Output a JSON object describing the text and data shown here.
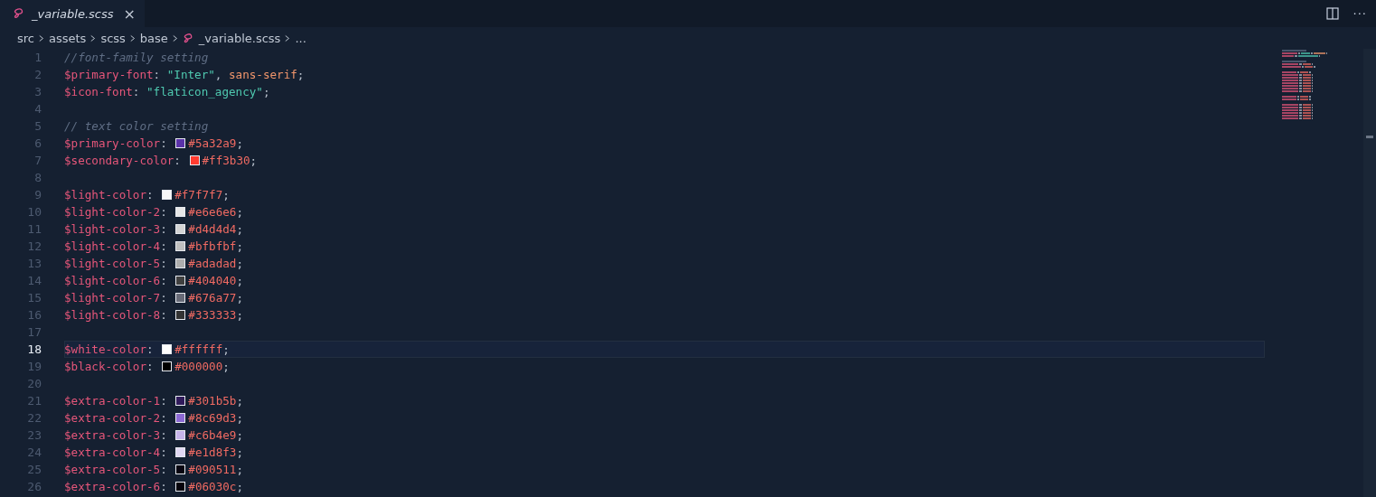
{
  "tab": {
    "label": "_variable.scss",
    "selected": true,
    "close": "×"
  },
  "breadcrumbs": [
    {
      "label": "src",
      "kind": "folder"
    },
    {
      "label": "assets",
      "kind": "folder"
    },
    {
      "label": "scss",
      "kind": "folder"
    },
    {
      "label": "base",
      "kind": "folder"
    },
    {
      "label": "_variable.scss",
      "kind": "file"
    },
    {
      "label": "...",
      "kind": "more"
    }
  ],
  "actions": {
    "more": "···"
  },
  "lines": [
    {
      "number": "1",
      "current": false,
      "tokens": [
        {
          "kind": "comment",
          "text": "//font-family setting"
        }
      ]
    },
    {
      "number": "2",
      "current": false,
      "tokens": [
        {
          "kind": "variable",
          "text": "$primary-font"
        },
        {
          "kind": "punct",
          "text": ": "
        },
        {
          "kind": "string",
          "text": "\"Inter\""
        },
        {
          "kind": "punct",
          "text": ", "
        },
        {
          "kind": "keyword",
          "text": "sans-serif"
        },
        {
          "kind": "punct",
          "text": ";"
        }
      ]
    },
    {
      "number": "3",
      "current": false,
      "tokens": [
        {
          "kind": "variable",
          "text": "$icon-font"
        },
        {
          "kind": "punct",
          "text": ": "
        },
        {
          "kind": "string",
          "text": "\"flaticon_agency\""
        },
        {
          "kind": "punct",
          "text": ";"
        }
      ]
    },
    {
      "number": "4",
      "current": false
    },
    {
      "number": "5",
      "current": false,
      "tokens": [
        {
          "kind": "comment",
          "text": "// text color setting"
        }
      ]
    },
    {
      "number": "6",
      "current": false,
      "tokens": [
        {
          "kind": "variable",
          "text": "$primary-color"
        },
        {
          "kind": "punct",
          "text": ": "
        },
        {
          "kind": "swatch",
          "color": "#5a32a9"
        },
        {
          "kind": "hex",
          "text": "#5a32a9"
        },
        {
          "kind": "punct",
          "text": ";"
        }
      ]
    },
    {
      "number": "7",
      "current": false,
      "tokens": [
        {
          "kind": "variable",
          "text": "$secondary-color"
        },
        {
          "kind": "punct",
          "text": ": "
        },
        {
          "kind": "swatch",
          "color": "#ff3b30"
        },
        {
          "kind": "hex",
          "text": "#ff3b30"
        },
        {
          "kind": "punct",
          "text": ";"
        }
      ]
    },
    {
      "number": "8",
      "current": false
    },
    {
      "number": "9",
      "current": false,
      "tokens": [
        {
          "kind": "variable",
          "text": "$light-color"
        },
        {
          "kind": "punct",
          "text": ": "
        },
        {
          "kind": "swatch",
          "color": "#f7f7f7"
        },
        {
          "kind": "hex",
          "text": "#f7f7f7"
        },
        {
          "kind": "punct",
          "text": ";"
        }
      ]
    },
    {
      "number": "10",
      "current": false,
      "tokens": [
        {
          "kind": "variable",
          "text": "$light-color-2"
        },
        {
          "kind": "punct",
          "text": ": "
        },
        {
          "kind": "swatch",
          "color": "#e6e6e6"
        },
        {
          "kind": "hex",
          "text": "#e6e6e6"
        },
        {
          "kind": "punct",
          "text": ";"
        }
      ]
    },
    {
      "number": "11",
      "current": false,
      "tokens": [
        {
          "kind": "variable",
          "text": "$light-color-3"
        },
        {
          "kind": "punct",
          "text": ": "
        },
        {
          "kind": "swatch",
          "color": "#d4d4d4"
        },
        {
          "kind": "hex",
          "text": "#d4d4d4"
        },
        {
          "kind": "punct",
          "text": ";"
        }
      ]
    },
    {
      "number": "12",
      "current": false,
      "tokens": [
        {
          "kind": "variable",
          "text": "$light-color-4"
        },
        {
          "kind": "punct",
          "text": ": "
        },
        {
          "kind": "swatch",
          "color": "#bfbfbf"
        },
        {
          "kind": "hex",
          "text": "#bfbfbf"
        },
        {
          "kind": "punct",
          "text": ";"
        }
      ]
    },
    {
      "number": "13",
      "current": false,
      "tokens": [
        {
          "kind": "variable",
          "text": "$light-color-5"
        },
        {
          "kind": "punct",
          "text": ": "
        },
        {
          "kind": "swatch",
          "color": "#adadad"
        },
        {
          "kind": "hex",
          "text": "#adadad"
        },
        {
          "kind": "punct",
          "text": ";"
        }
      ]
    },
    {
      "number": "14",
      "current": false,
      "tokens": [
        {
          "kind": "variable",
          "text": "$light-color-6"
        },
        {
          "kind": "punct",
          "text": ": "
        },
        {
          "kind": "swatch",
          "color": "#404040"
        },
        {
          "kind": "hex",
          "text": "#404040"
        },
        {
          "kind": "punct",
          "text": ";"
        }
      ]
    },
    {
      "number": "15",
      "current": false,
      "tokens": [
        {
          "kind": "variable",
          "text": "$light-color-7"
        },
        {
          "kind": "punct",
          "text": ": "
        },
        {
          "kind": "swatch",
          "color": "#676a77"
        },
        {
          "kind": "hex",
          "text": "#676a77"
        },
        {
          "kind": "punct",
          "text": ";"
        }
      ]
    },
    {
      "number": "16",
      "current": false,
      "tokens": [
        {
          "kind": "variable",
          "text": "$light-color-8"
        },
        {
          "kind": "punct",
          "text": ": "
        },
        {
          "kind": "swatch",
          "color": "#333333"
        },
        {
          "kind": "hex",
          "text": "#333333"
        },
        {
          "kind": "punct",
          "text": ";"
        }
      ]
    },
    {
      "number": "17",
      "current": false
    },
    {
      "number": "18",
      "current": true,
      "tokens": [
        {
          "kind": "variable",
          "text": "$white-color"
        },
        {
          "kind": "punct",
          "text": ": "
        },
        {
          "kind": "swatch",
          "color": "#ffffff"
        },
        {
          "kind": "hex",
          "text": "#ffffff"
        },
        {
          "kind": "punct",
          "text": ";"
        }
      ]
    },
    {
      "number": "19",
      "current": false,
      "tokens": [
        {
          "kind": "variable",
          "text": "$black-color"
        },
        {
          "kind": "punct",
          "text": ": "
        },
        {
          "kind": "swatch",
          "color": "#000000"
        },
        {
          "kind": "hex",
          "text": "#000000"
        },
        {
          "kind": "punct",
          "text": ";"
        }
      ]
    },
    {
      "number": "20",
      "current": false
    },
    {
      "number": "21",
      "current": false,
      "tokens": [
        {
          "kind": "variable",
          "text": "$extra-color-1"
        },
        {
          "kind": "punct",
          "text": ": "
        },
        {
          "kind": "swatch",
          "color": "#301b5b"
        },
        {
          "kind": "hex",
          "text": "#301b5b"
        },
        {
          "kind": "punct",
          "text": ";"
        }
      ]
    },
    {
      "number": "22",
      "current": false,
      "tokens": [
        {
          "kind": "variable",
          "text": "$extra-color-2"
        },
        {
          "kind": "punct",
          "text": ": "
        },
        {
          "kind": "swatch",
          "color": "#8c69d3"
        },
        {
          "kind": "hex",
          "text": "#8c69d3"
        },
        {
          "kind": "punct",
          "text": ";"
        }
      ]
    },
    {
      "number": "23",
      "current": false,
      "tokens": [
        {
          "kind": "variable",
          "text": "$extra-color-3"
        },
        {
          "kind": "punct",
          "text": ": "
        },
        {
          "kind": "swatch",
          "color": "#c6b4e9"
        },
        {
          "kind": "hex",
          "text": "#c6b4e9"
        },
        {
          "kind": "punct",
          "text": ";"
        }
      ]
    },
    {
      "number": "24",
      "current": false,
      "tokens": [
        {
          "kind": "variable",
          "text": "$extra-color-4"
        },
        {
          "kind": "punct",
          "text": ": "
        },
        {
          "kind": "swatch",
          "color": "#e1d8f3"
        },
        {
          "kind": "hex",
          "text": "#e1d8f3"
        },
        {
          "kind": "punct",
          "text": ";"
        }
      ]
    },
    {
      "number": "25",
      "current": false,
      "tokens": [
        {
          "kind": "variable",
          "text": "$extra-color-5"
        },
        {
          "kind": "punct",
          "text": ": "
        },
        {
          "kind": "swatch",
          "color": "#090511"
        },
        {
          "kind": "hex",
          "text": "#090511"
        },
        {
          "kind": "punct",
          "text": ";"
        }
      ]
    },
    {
      "number": "26",
      "current": false,
      "tokens": [
        {
          "kind": "variable",
          "text": "$extra-color-6"
        },
        {
          "kind": "punct",
          "text": ": "
        },
        {
          "kind": "swatch",
          "color": "#06030c"
        },
        {
          "kind": "hex",
          "text": "#06030c"
        },
        {
          "kind": "punct",
          "text": ";"
        }
      ]
    }
  ]
}
